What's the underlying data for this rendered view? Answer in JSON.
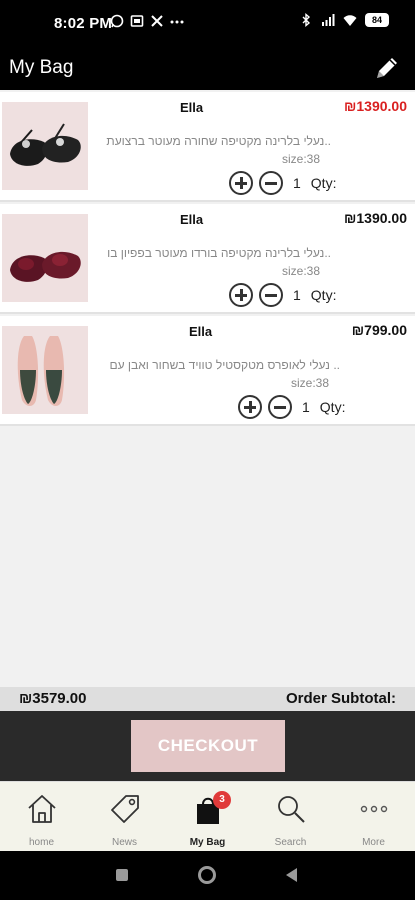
{
  "status_bar": {
    "time": "8:02 PM",
    "battery": "84",
    "icons": [
      "whatsapp-icon",
      "notification-icon",
      "tools-icon",
      "more-dots-icon",
      "bluetooth-icon",
      "signal-icon",
      "wifi-icon",
      "battery-icon"
    ]
  },
  "header": {
    "title": "My Bag",
    "edit_icon": "pencil-icon"
  },
  "items": [
    {
      "brand": "Ella",
      "price": "₪1390.00",
      "price_color": "#d92020",
      "description": "נעלי בלרינה מקטיפה שחורה מעוטר ברצועת..",
      "size": "size:38",
      "qty": "1",
      "qty_label": "Qty:"
    },
    {
      "brand": "Ella",
      "price": "₪1390.00",
      "price_color": "#111111",
      "description": "נעלי בלרינה מקטיפה בורדו מעוטר בפפיון בו..",
      "size": "size:38",
      "qty": "1",
      "qty_label": "Qty:"
    },
    {
      "brand": "Ella",
      "price": "₪799.00",
      "price_color": "#111111",
      "description": "נעלי לאופרס מטקסטיל טוויד בשחור ואבן עם ..",
      "size": "size:38",
      "qty": "1",
      "qty_label": "Qty:"
    }
  ],
  "subtotal": {
    "amount": "₪3579.00",
    "label": "Order Subtotal:"
  },
  "checkout": {
    "label": "CHECKOUT",
    "color": "#e3c6c6"
  },
  "bottom_nav": [
    {
      "label": "home",
      "icon": "home-icon"
    },
    {
      "label": "News",
      "icon": "tag-icon"
    },
    {
      "label": "My Bag",
      "icon": "shopping-bag-icon",
      "badge": "3"
    },
    {
      "label": "Search",
      "icon": "search-icon"
    },
    {
      "label": "More",
      "icon": "more-dots-icon"
    }
  ]
}
